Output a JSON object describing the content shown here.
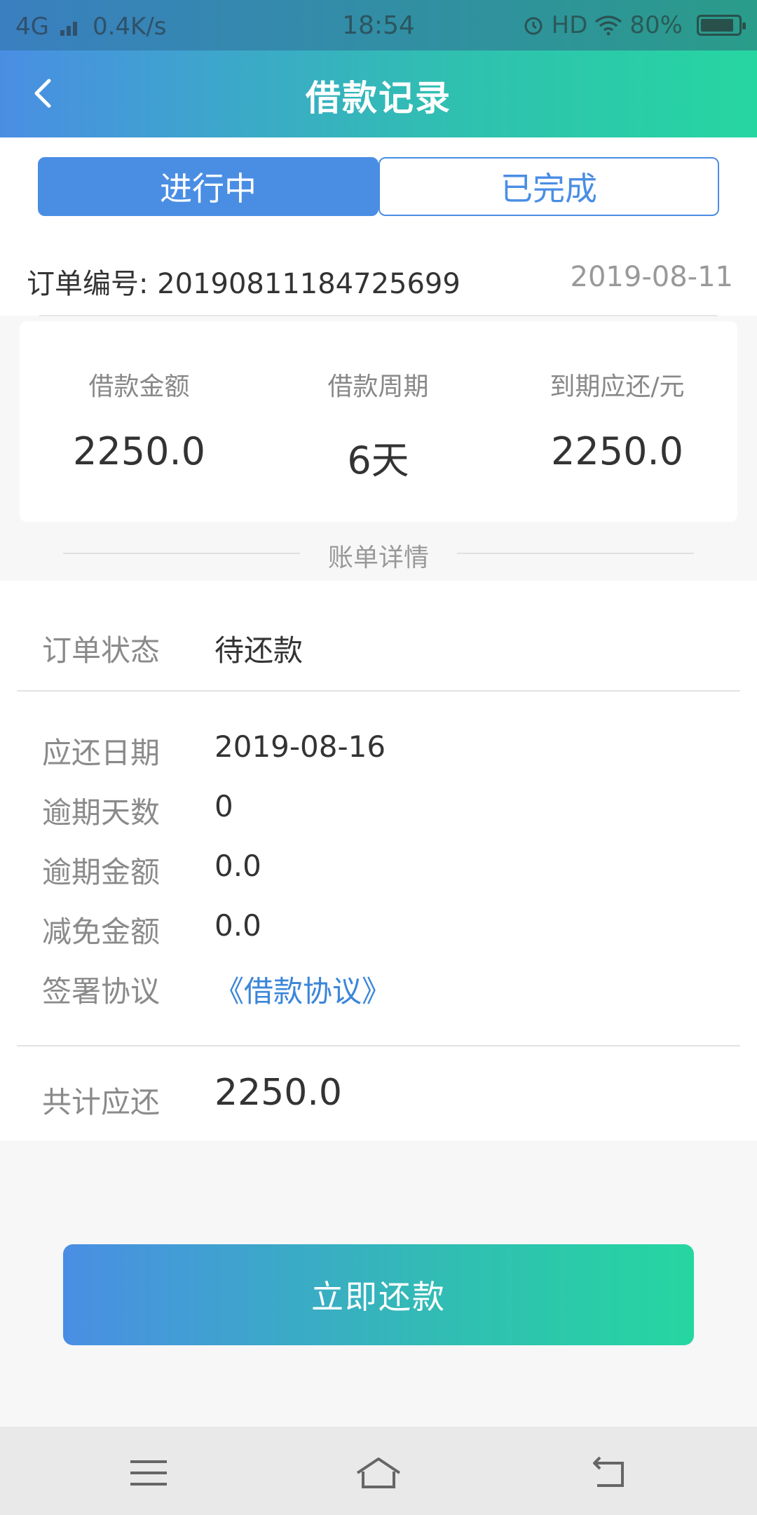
{
  "status_bar": {
    "network": "4G",
    "speed": "0.4K/s",
    "time": "18:54",
    "hd": "HD",
    "battery": "80%"
  },
  "nav": {
    "title": "借款记录"
  },
  "tabs": [
    {
      "label": "进行中"
    },
    {
      "label": "已完成"
    }
  ],
  "order": {
    "number_label": "订单编号: 20190811184725699",
    "date": "2019-08-11"
  },
  "summary": [
    {
      "label": "借款金额",
      "value": "2250.0"
    },
    {
      "label": "借款周期",
      "value": "6天"
    },
    {
      "label": "到期应还/元",
      "value": "2250.0"
    }
  ],
  "bill": {
    "header": "账单详情",
    "status": {
      "label": "订单状态",
      "value": "待还款"
    },
    "items": [
      {
        "label": "应还日期",
        "value": "2019-08-16"
      },
      {
        "label": "逾期天数",
        "value": "0"
      },
      {
        "label": "逾期金额",
        "value": "0.0"
      },
      {
        "label": "减免金额",
        "value": "0.0"
      },
      {
        "label": "签署协议",
        "value": "《借款协议》"
      }
    ],
    "total": {
      "label": "共计应还",
      "value": "2250.0"
    }
  },
  "actions": {
    "repay_label": "立即还款"
  },
  "colors": {
    "accent": "#4a8ee4",
    "gradient_end": "#26d6a1",
    "link": "#3b86d8"
  }
}
